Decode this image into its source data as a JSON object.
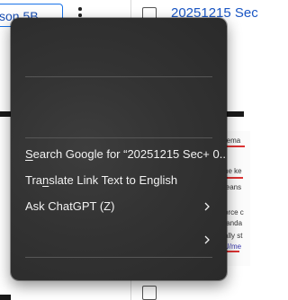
{
  "background": {
    "lesson_chip_label": "son 5B",
    "document_name": "20251215 Sec",
    "thumbnail_texts": [
      "rema",
      "he ke",
      "leans",
      "orce c",
      "tanda",
      "ally st",
      "U/me"
    ]
  },
  "menu": {
    "search_prefix": "S",
    "search_rest": "earch Google for “20251215 Sec+ 0...”",
    "translate_pre": "Tra",
    "translate_u": "n",
    "translate_post": "slate Link Text to English",
    "ask_chatgpt_label": "Ask ChatGPT (Z)",
    "empty_submenu_label": ""
  },
  "colors": {
    "menu_bg": "#333333",
    "menu_text": "#f2f2f2",
    "separator": "#575757",
    "link_blue": "#1a56c4",
    "chip_border": "#1a73e8"
  }
}
